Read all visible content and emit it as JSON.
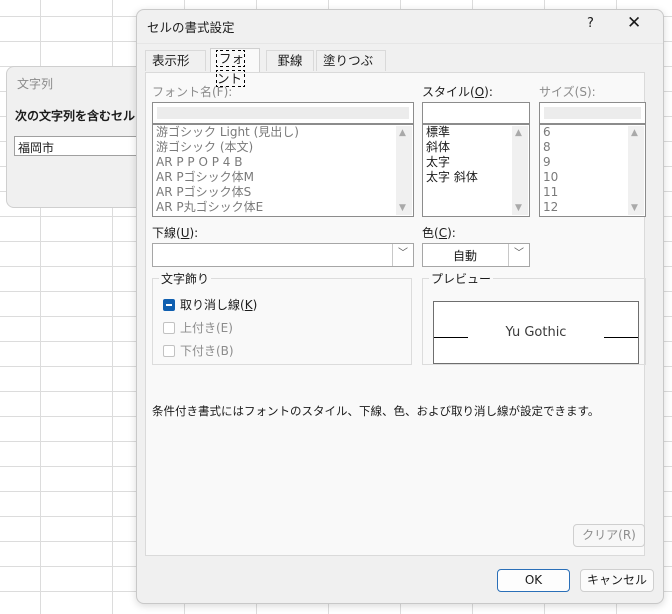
{
  "background_dialog": {
    "title": "文字列",
    "prompt": "次の文字列を含むセルを書",
    "input_value": "福岡市"
  },
  "dialog": {
    "title": "セルの書式設定",
    "help_label": "?",
    "close_label": "✕",
    "tabs": [
      {
        "label": "表示形式",
        "active": false
      },
      {
        "label": "フォント",
        "active": true
      },
      {
        "label": "罫線",
        "active": false
      },
      {
        "label": "塗りつぶし",
        "active": false
      }
    ],
    "font_name": {
      "label": "フォント名(F):",
      "value": "",
      "options": [
        "游ゴシック Light (見出し)",
        "游ゴシック (本文)",
        "AR P P O P 4 B",
        "AR Pゴシック体M",
        "AR Pゴシック体S",
        "AR P丸ゴシック体E"
      ]
    },
    "style": {
      "label_prefix": "スタイル(",
      "label_key": "O",
      "label_suffix": "):",
      "value": "",
      "options": [
        "標準",
        "斜体",
        "太字",
        "太字 斜体"
      ]
    },
    "size": {
      "label": "サイズ(S):",
      "value": "",
      "options": [
        "6",
        "8",
        "9",
        "10",
        "11",
        "12"
      ]
    },
    "underline": {
      "label_prefix": "下線(",
      "label_key": "U",
      "label_suffix": "):",
      "value": ""
    },
    "color": {
      "label_prefix": "色(",
      "label_key": "C",
      "label_suffix": "):",
      "value": "自動"
    },
    "effects": {
      "legend": "文字飾り",
      "strikethrough": {
        "label_prefix": "取り消し線(",
        "label_key": "K",
        "label_suffix": ")",
        "state": "indeterminate"
      },
      "superscript": {
        "label": "上付き(E)",
        "enabled": false
      },
      "subscript": {
        "label": "下付き(B)",
        "enabled": false
      }
    },
    "preview": {
      "legend": "プレビュー",
      "sample_text": "Yu Gothic"
    },
    "note": "条件付き書式にはフォントのスタイル、下線、色、および取り消し線が設定できます。",
    "clear_button": "クリア(R)",
    "ok_button": "OK",
    "cancel_button": "キャンセル"
  }
}
